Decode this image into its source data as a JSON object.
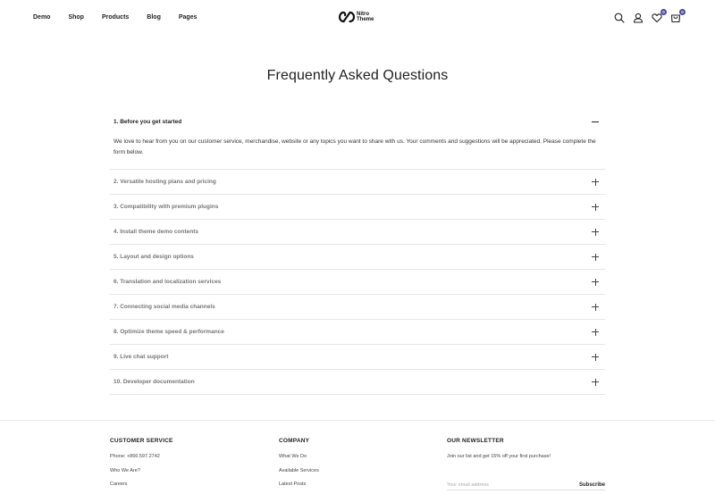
{
  "header": {
    "nav": [
      "Demo",
      "Shop",
      "Products",
      "Blog",
      "Pages"
    ],
    "logo_line1": "Nitro",
    "logo_line2": "Theme",
    "wishlist_count": "0",
    "cart_count": "0",
    "icons": [
      "search-icon",
      "user-icon",
      "heart-icon",
      "cart-icon"
    ]
  },
  "page": {
    "title": "Frequently Asked Questions"
  },
  "faq": [
    {
      "q": "1. Before you get started",
      "open": true,
      "a": "We love to hear from you on our customer service, merchandise, website or any topics you want to share with us. Your comments and suggestions will be appreciated. Please complete the form below."
    },
    {
      "q": "2. Versatile hosting plans and pricing",
      "open": false
    },
    {
      "q": "3. Compatibility with premium plugins",
      "open": false
    },
    {
      "q": "4. Install theme demo contents",
      "open": false
    },
    {
      "q": "5. Layout and design options",
      "open": false
    },
    {
      "q": "6. Translation and localization services",
      "open": false
    },
    {
      "q": "7. Connecting social media channels",
      "open": false
    },
    {
      "q": "8. Optimize theme speed & performance",
      "open": false
    },
    {
      "q": "9. Live chat support",
      "open": false
    },
    {
      "q": "10. Developer documentation",
      "open": false
    }
  ],
  "footer": {
    "customer_service": {
      "heading": "CUSTOMER SERVICE",
      "links": [
        "Phone: +866.597.2742",
        "Who We Are?",
        "Careers"
      ]
    },
    "company": {
      "heading": "COMPANY",
      "links": [
        "What We Do",
        "Available Services",
        "Latest Posts"
      ]
    },
    "newsletter": {
      "heading": "OUR NEWSLETTER",
      "text": "Join our list and get 15% off your first purchase!",
      "placeholder": "Your email address",
      "button": "Subscribe"
    }
  },
  "colors": {
    "accent": "#4a4ca0",
    "text": "#222222",
    "muted": "#777777",
    "divider": "#e6e6e6"
  }
}
